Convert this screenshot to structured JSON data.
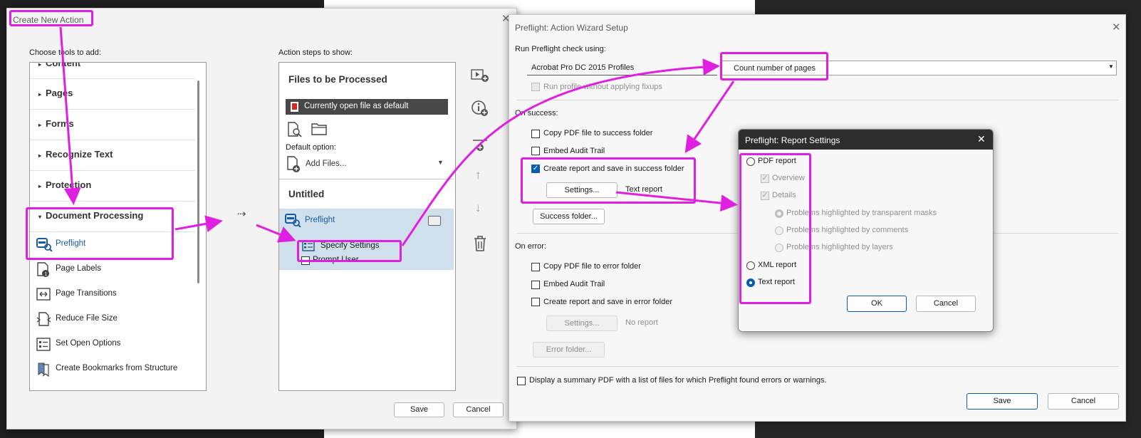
{
  "create_dialog": {
    "title": "Create New Action",
    "choose_tools_label": "Choose tools to add:",
    "action_steps_label": "Action steps to show:",
    "categories": [
      {
        "label": "Content"
      },
      {
        "label": "Pages"
      },
      {
        "label": "Forms"
      },
      {
        "label": "Recognize Text"
      },
      {
        "label": "Protection"
      },
      {
        "label": "Document Processing"
      }
    ],
    "tools": [
      {
        "label": "Preflight",
        "icon": "preflight-icon"
      },
      {
        "label": "Page Labels",
        "icon": "page-labels-icon"
      },
      {
        "label": "Page Transitions",
        "icon": "page-transitions-icon"
      },
      {
        "label": "Reduce File Size",
        "icon": "reduce-file-size-icon"
      },
      {
        "label": "Set Open Options",
        "icon": "set-open-options-icon"
      },
      {
        "label": "Create Bookmarks from Structure",
        "icon": "bookmarks-icon"
      }
    ],
    "files_header": "Files to be Processed",
    "current_file": "Currently open file as default",
    "default_option_label": "Default option:",
    "add_files": "Add Files...",
    "untitled": "Untitled",
    "step_preflight": "Preflight",
    "step_specify": "Specify Settings",
    "step_prompt": "Prompt User",
    "save": "Save",
    "cancel": "Cancel"
  },
  "wizard": {
    "title": "Preflight: Action Wizard Setup",
    "run_label": "Run Preflight check using:",
    "profile_select": "Acrobat Pro DC 2015 Profiles",
    "check_select": "Count number of pages",
    "run_without_fixups": "Run profile without applying fixups",
    "on_success": "On success:",
    "copy_success": "Copy PDF file to success folder",
    "embed_audit_success": "Embed Audit Trail",
    "create_report_success": "Create report and save in success folder",
    "settings_success": "Settings...",
    "text_report": "Text report",
    "success_folder": "Success folder...",
    "on_error": "On error:",
    "copy_error": "Copy PDF file to error folder",
    "embed_audit_error": "Embed Audit Trail",
    "create_report_error": "Create report and save in error folder",
    "settings_error": "Settings...",
    "no_report": "No report",
    "error_folder": "Error folder...",
    "summary": "Display a summary PDF with a list of files for which Preflight found errors or warnings.",
    "save": "Save",
    "cancel": "Cancel"
  },
  "report": {
    "title": "Preflight: Report Settings",
    "pdf_report": "PDF report",
    "overview": "Overview",
    "details": "Details",
    "opt_masks": "Problems highlighted by transparent masks",
    "opt_comments": "Problems highlighted by comments",
    "opt_layers": "Problems highlighted by layers",
    "xml_report": "XML report",
    "text_report": "Text report",
    "ok": "OK",
    "cancel": "Cancel"
  },
  "accent_color": "#e020e0",
  "brand_blue": "#0b5cad",
  "pdf_red": "#d7271f"
}
